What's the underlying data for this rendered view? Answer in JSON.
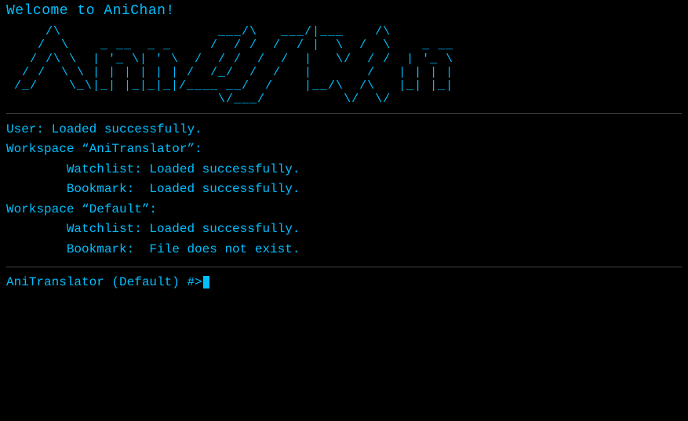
{
  "welcome": {
    "line": "Welcome to AniChan!"
  },
  "ascii_art": {
    "lines": [
      "     /\\                    ___/\\   ___/|___    /\\",
      "    /  \\    _ __  _ _     /  / /  /  / |  \\  /  \\    _ __",
      "   / /\\ \\  | '_ \\| ' \\  /  / /  /  /  |   \\/  / /  | '_ \\",
      "  / /  \\ \\ | | | | | | /  /_/  /  /   |       /   | | | |",
      " /_/    \\_\\|_| |_|_|_|/____ __/  /    |__/\\  /\\   |_| |_|",
      "                           \\/___/          \\/  \\/"
    ]
  },
  "status": {
    "lines": [
      "User: Loaded successfully.",
      "Workspace “AniTranslator”:",
      "        Watchlist: Loaded successfully.",
      "        Bookmark:  Loaded successfully.",
      "Workspace “Default”:",
      "        Watchlist: Loaded successfully.",
      "        Bookmark:  File does not exist."
    ]
  },
  "prompt": {
    "text": "AniTranslator (Default) #>"
  }
}
